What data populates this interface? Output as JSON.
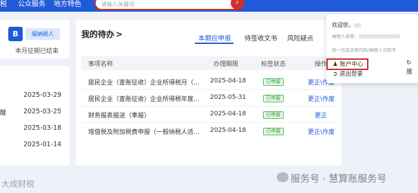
{
  "nav": {
    "items": [
      "税",
      "公众服务",
      "地方特色"
    ],
    "search_placeholder": "请输入关键词",
    "search_icon": "search-icon"
  },
  "profile": {
    "badge": "B",
    "taxpayer_type": "级纳税人",
    "period_status": "本月征期已结束"
  },
  "reminders": {
    "label": "醒",
    "dates": [
      "2025-03-29",
      "2025-03-25",
      "2025-03-18",
      "2025-01-14"
    ]
  },
  "todo": {
    "title": "我的待办",
    "title_chevron": ">",
    "tabs": [
      "本期应申报",
      "待签收文书",
      "风险疑点"
    ],
    "columns": [
      "事项名称",
      "办理期限",
      "标签状态",
      "操作"
    ],
    "rows": [
      {
        "name": "居民企业（查账征收）企业所得税月（...",
        "deadline": "2025-04-18",
        "status": "已申报",
        "action": "更正\\作废"
      },
      {
        "name": "居民企业（查账征收）企业所得税年度...",
        "deadline": "2025-05-31",
        "status": "已申报",
        "action": "更正\\作废"
      },
      {
        "name": "财务报表报送（季报）",
        "deadline": "2025-04-18",
        "status": "已申报",
        "action": "更正"
      },
      {
        "name": "增值税及附加税费申报（一般纳税人适...",
        "deadline": "2025-04-18",
        "status": "已申报",
        "action": "更正\\作废"
      }
    ]
  },
  "dropdown": {
    "welcome": "欢迎您，",
    "taxpayer_name_label": "纳税人名称：",
    "credit_code_label": "统一社会信用代码/纳税人识别号",
    "account_center": "账户中心",
    "logout": "退出登录",
    "refresh": "度"
  },
  "watermarks": {
    "left": "大成财税",
    "right": "服务号 · 慧算账服务号"
  },
  "colors": {
    "primary": "#1f5bd8",
    "highlight": "#d22d2d",
    "success": "#2e9c38"
  }
}
